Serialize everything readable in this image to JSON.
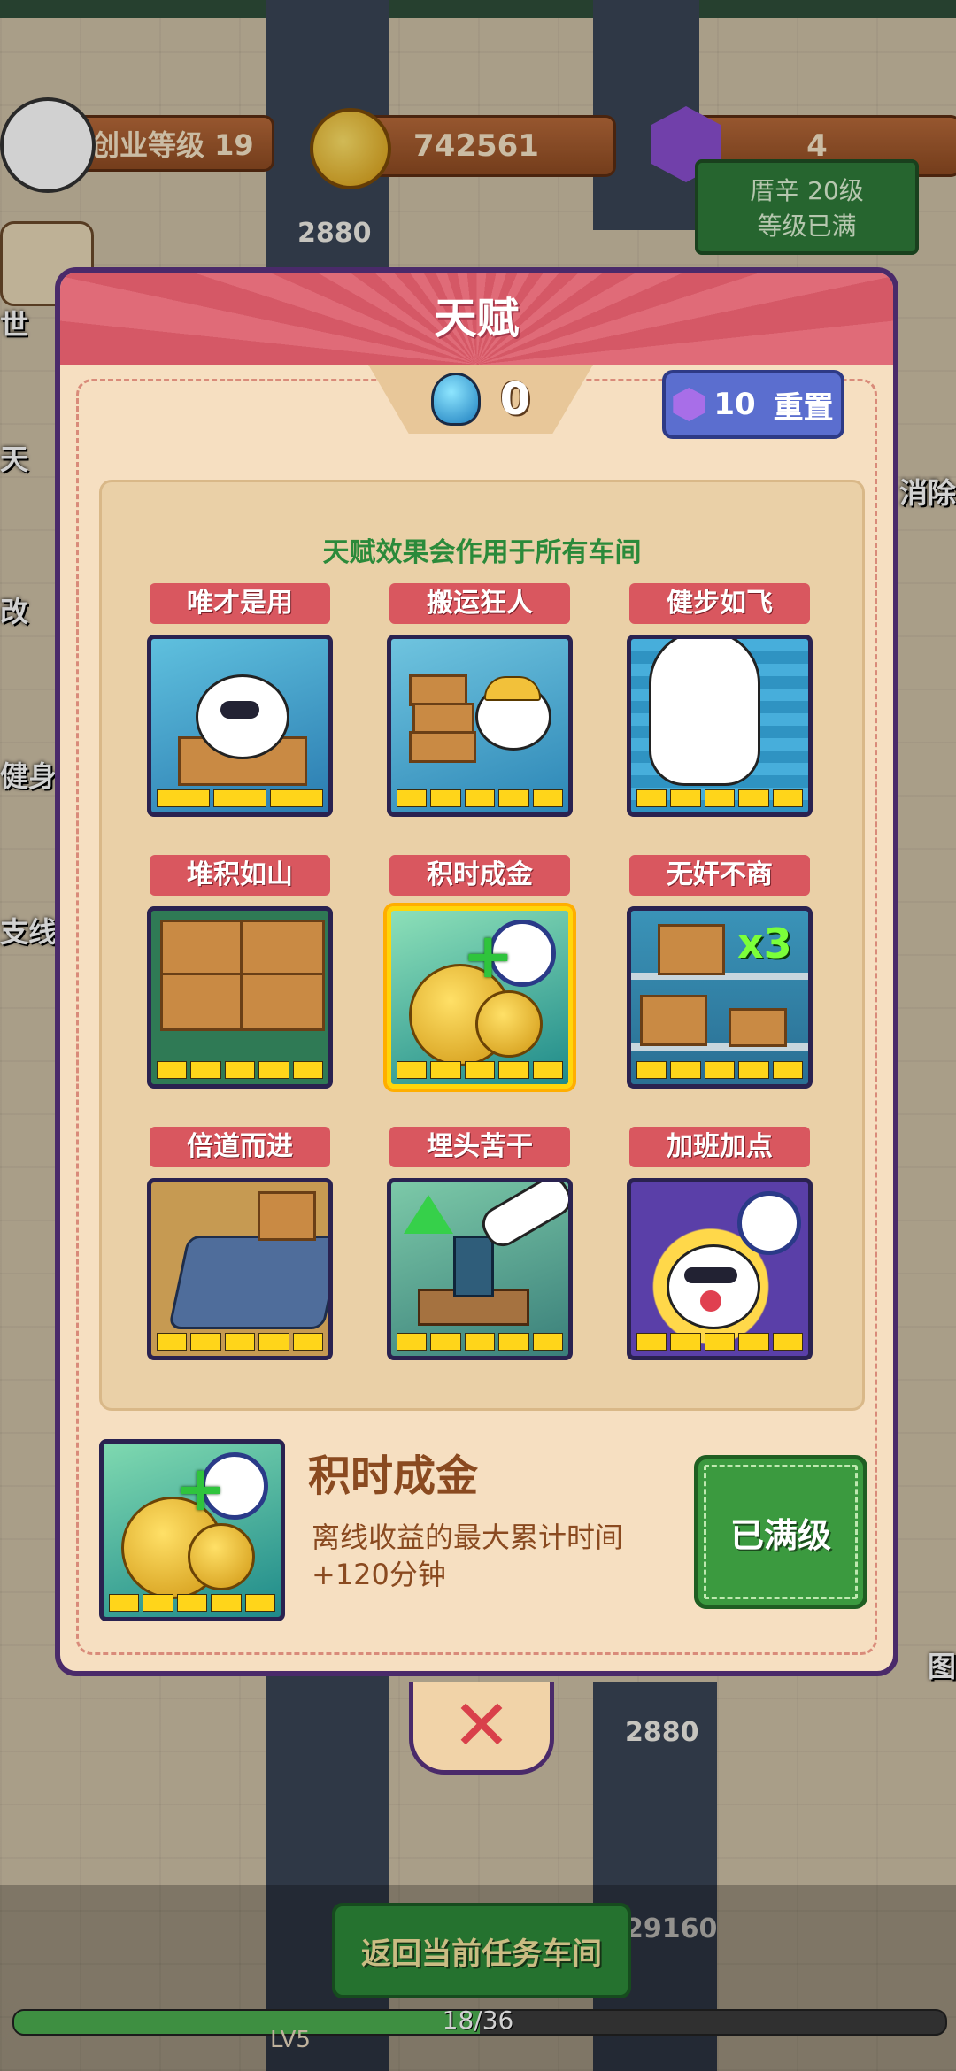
{
  "hud": {
    "level_label": "创业等级 19",
    "coins": "742561",
    "gems": "4",
    "sign_line1": "厝辛 20级",
    "sign_line2": "等级已满"
  },
  "background": {
    "num_top": "2880",
    "num_bottom": "2880",
    "num_bottom2": "29160",
    "left_labels": [
      "世",
      "天",
      "改",
      "健身",
      "支线"
    ],
    "right_labels": [
      "消除",
      "图"
    ]
  },
  "dialog": {
    "title": "天赋",
    "talent_points": "0",
    "reset_cost": "10",
    "reset_label": "重置",
    "hint": "天赋效果会作用于所有车间",
    "talents": [
      {
        "name": "唯才是用",
        "pips": 3,
        "filled": 3,
        "selected": false
      },
      {
        "name": "搬运狂人",
        "pips": 5,
        "filled": 5,
        "selected": false
      },
      {
        "name": "健步如飞",
        "pips": 5,
        "filled": 5,
        "selected": false
      },
      {
        "name": "堆积如山",
        "pips": 5,
        "filled": 5,
        "selected": false
      },
      {
        "name": "积时成金",
        "pips": 5,
        "filled": 5,
        "selected": true
      },
      {
        "name": "无奸不商",
        "pips": 5,
        "filled": 5,
        "selected": false
      },
      {
        "name": "倍道而进",
        "pips": 5,
        "filled": 5,
        "selected": false
      },
      {
        "name": "埋头苦干",
        "pips": 5,
        "filled": 5,
        "selected": false
      },
      {
        "name": "加班加点",
        "pips": 5,
        "filled": 5,
        "selected": false
      }
    ],
    "detail": {
      "name": "积时成金",
      "desc_line1": "离线收益的最大累计时间",
      "desc_line2": "+120分钟",
      "pips": 5,
      "filled": 5,
      "button": "已满级"
    },
    "multiplier_badge": "x3",
    "close_glyph": "✕"
  },
  "bottom": {
    "return_button": "返回当前任务车间",
    "progress_text": "18/36",
    "progress_value": 0.5,
    "lv_text": "LV5"
  }
}
